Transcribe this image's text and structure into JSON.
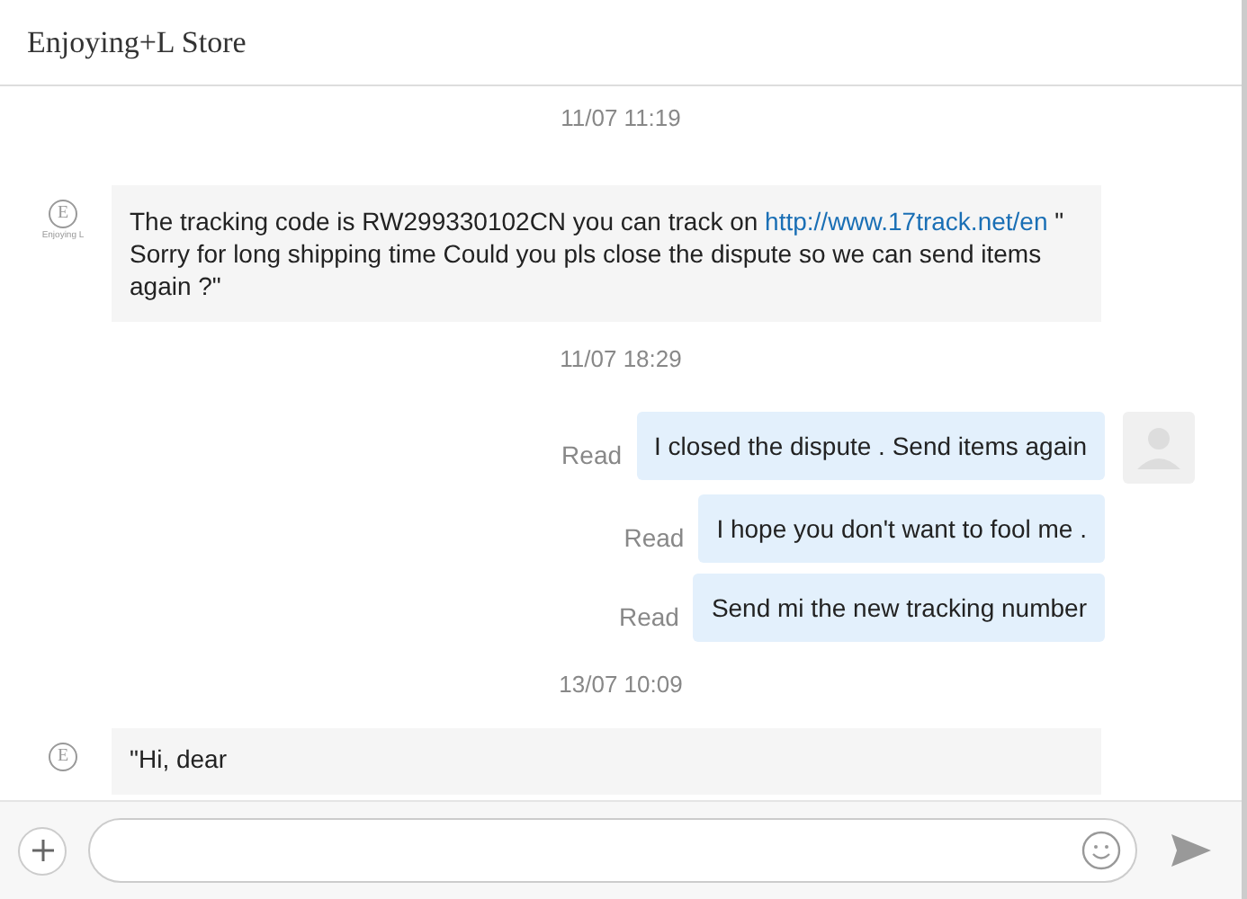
{
  "header": {
    "title": "Enjoying+L Store"
  },
  "messages": [
    {
      "kind": "time",
      "text": "11/07 11:19"
    },
    {
      "kind": "incoming",
      "avatar_letter": "E",
      "avatar_caption": "Enjoying L",
      "parts": [
        {
          "kind": "text",
          "text": "The tracking code is RW299330102CN you can track on "
        },
        {
          "kind": "link",
          "text": "http://www.17track.net/en"
        },
        {
          "kind": "text",
          "text": " \" Sorry for long shipping time Could you pls close the dispute so we can send items again ?\""
        }
      ]
    },
    {
      "kind": "time",
      "text": "11/07 18:29"
    },
    {
      "kind": "outgoing",
      "status": "Read",
      "avatar": true,
      "text": "I closed the dispute . Send items again"
    },
    {
      "kind": "outgoing",
      "status": "Read",
      "avatar": false,
      "text": "I hope you don't want to fool me ."
    },
    {
      "kind": "outgoing",
      "status": "Read",
      "avatar": false,
      "text": "Send mi the new tracking number"
    },
    {
      "kind": "time",
      "text": "13/07 10:09"
    },
    {
      "kind": "incoming",
      "avatar_letter": "E",
      "parts": [
        {
          "kind": "text",
          "text": "\"Hi, dear"
        }
      ]
    }
  ]
}
